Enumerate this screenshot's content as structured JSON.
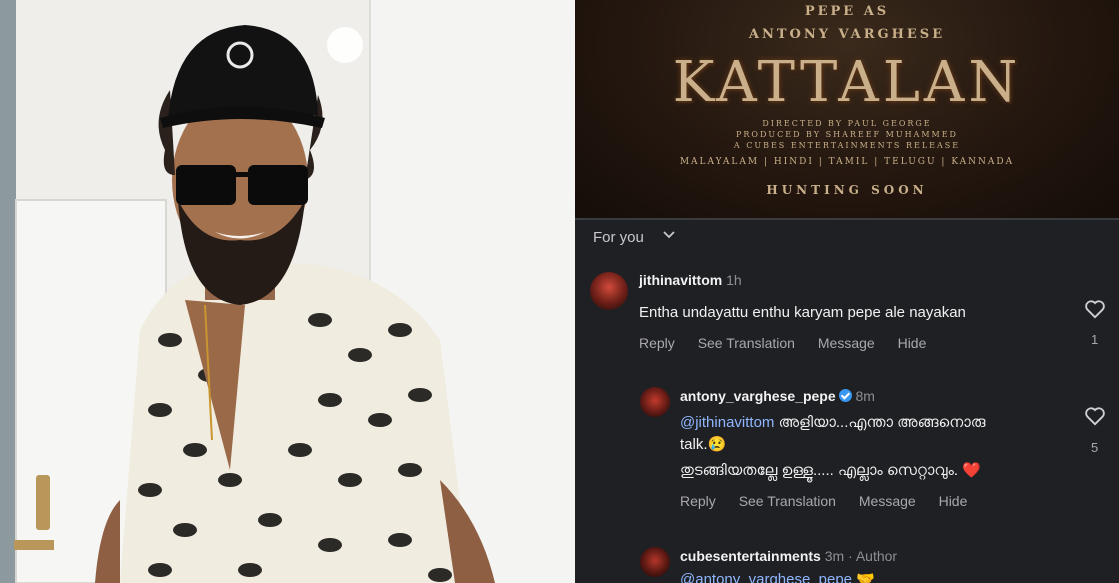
{
  "poster": {
    "top_line": "PEPE AS",
    "actor": "ANTONY VARGHESE",
    "title": "KATTALAN",
    "credits": [
      "DIRECTED BY PAUL GEORGE",
      "PRODUCED BY SHAREEF MUHAMMED",
      "A CUBES ENTERTAINMENTS RELEASE"
    ],
    "languages": "MALAYALAM  |  HINDI  |  TAMIL  |  TELUGU  |  KANNADA",
    "coming": "HUNTING SOON"
  },
  "feed_filter": "For you",
  "comments": [
    {
      "username": "jithinavittom",
      "time": "1h",
      "text": "Entha undayattu enthu karyam pepe ale nayakan",
      "actions": [
        "Reply",
        "See Translation",
        "Message",
        "Hide"
      ],
      "likes": "1"
    },
    {
      "username": "antony_varghese_pepe",
      "verified": true,
      "time": "8m",
      "mention": "@jithinavittom",
      "line1_rest": " അളിയാ...എന്താ അങ്ങനൊരു",
      "line2": "talk.",
      "line2_emoji": "😢",
      "line3": "തുടങ്ങിയതല്ലേ ഉള്ളൂ..... എല്ലാം സെറ്റാവും.",
      "line3_emoji": "❤️",
      "actions": [
        "Reply",
        "See Translation",
        "Message",
        "Hide"
      ],
      "likes": "5"
    },
    {
      "username": "cubesentertainments",
      "time": "3m",
      "role": "Author",
      "mention": "@antony_varghese_pepe",
      "emoji": "🤝"
    }
  ],
  "colors": {
    "panel_bg": "#1f2024",
    "mention": "#8fb6ff",
    "poster_gold": "#c8a070"
  },
  "icons": [
    "chevron-down-icon",
    "heart-icon",
    "verified-badge-icon"
  ]
}
